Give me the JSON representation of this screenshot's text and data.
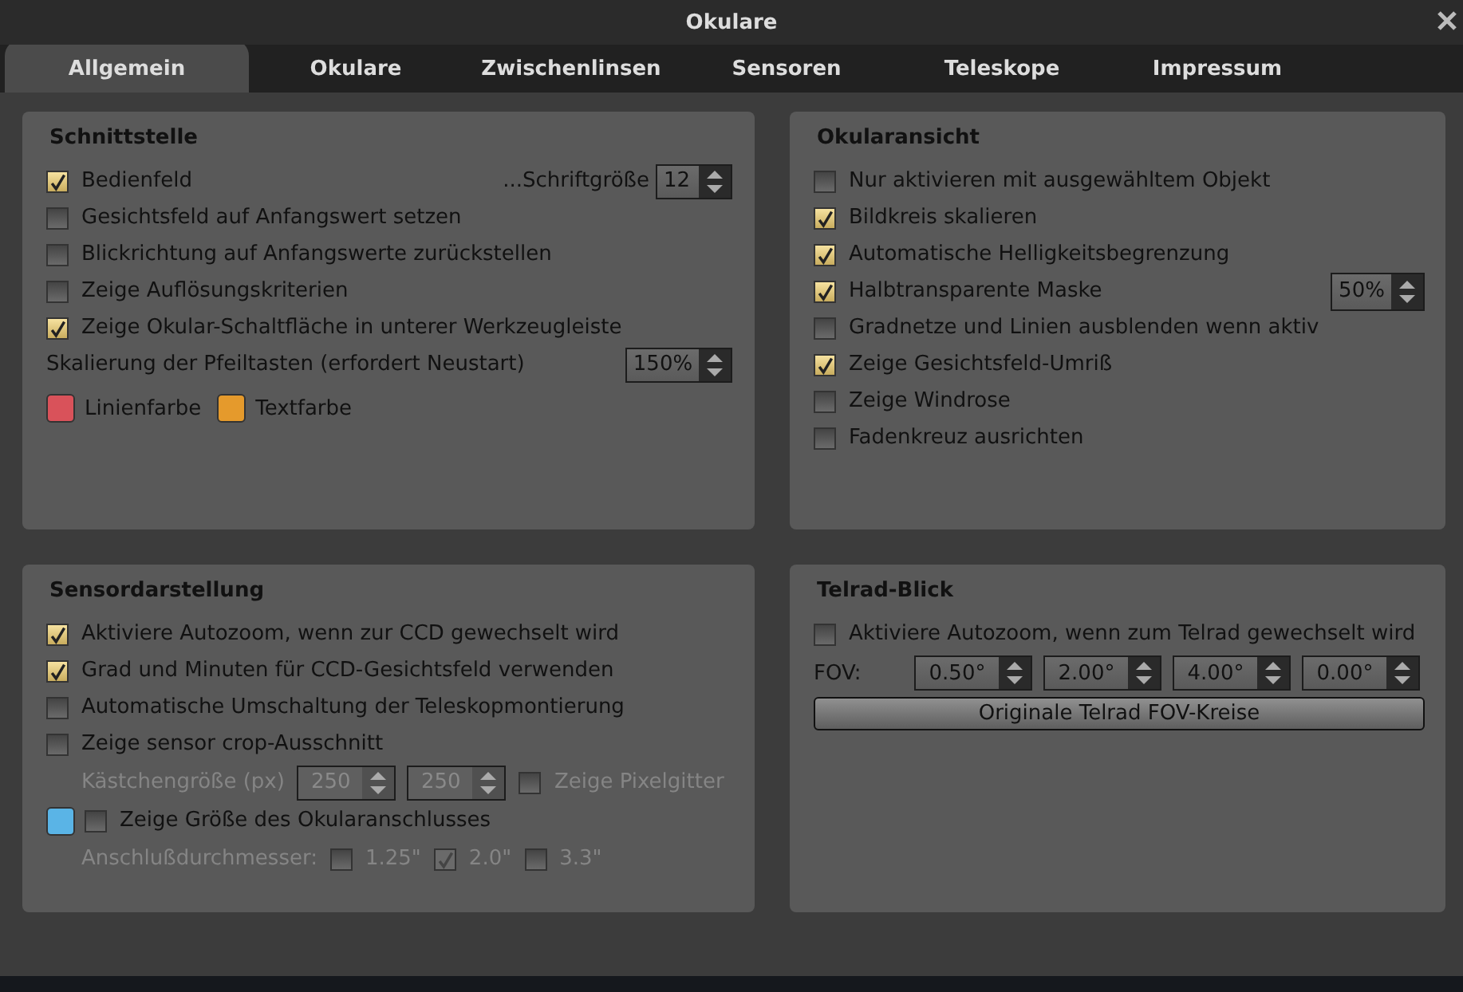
{
  "window": {
    "title": "Okulare"
  },
  "tabs": [
    {
      "label": "Allgemein",
      "selected": true
    },
    {
      "label": "Okulare",
      "selected": false
    },
    {
      "label": "Zwischenlinsen",
      "selected": false
    },
    {
      "label": "Sensoren",
      "selected": false
    },
    {
      "label": "Teleskope",
      "selected": false
    },
    {
      "label": "Impressum",
      "selected": false
    }
  ],
  "panels": [
    {
      "title": "Schnittstelle",
      "rows": [
        {
          "kind": "check",
          "label": "Bedienfeld",
          "checked": true,
          "extra": {
            "label": "...Schriftgröße",
            "value": "12"
          }
        },
        {
          "kind": "check",
          "label": "Gesichtsfeld auf Anfangswert setzen",
          "checked": false
        },
        {
          "kind": "check",
          "label": "Blickrichtung auf Anfangswerte zurückstellen",
          "checked": false
        },
        {
          "kind": "check",
          "label": "Zeige Auflösungskriterien",
          "checked": false
        },
        {
          "kind": "check",
          "label": "Zeige Okular-Schaltfläche in unterer Werkzeugleiste",
          "checked": true
        },
        {
          "kind": "spin",
          "label": "Skalierung der Pfeiltasten (erfordert Neustart)",
          "value": "150%"
        },
        {
          "kind": "colors",
          "swatches": [
            {
              "label": "Linienfarbe",
              "color": "#d9525a"
            },
            {
              "label": "Textfarbe",
              "color": "#e59a2c"
            }
          ]
        }
      ]
    },
    {
      "title": "Okularansicht",
      "rows": [
        {
          "kind": "check",
          "label": "Nur aktivieren mit ausgewähltem Objekt",
          "checked": false
        },
        {
          "kind": "check",
          "label": "Bildkreis skalieren",
          "checked": true
        },
        {
          "kind": "check",
          "label": "Automatische Helligkeitsbegrenzung",
          "checked": true
        },
        {
          "kind": "check",
          "label": "Halbtransparente Maske",
          "checked": true,
          "extra": {
            "value": "50%"
          }
        },
        {
          "kind": "check",
          "label": "Gradnetze und Linien ausblenden wenn aktiv",
          "checked": false
        },
        {
          "kind": "check",
          "label": "Zeige Gesichtsfeld-Umriß",
          "checked": true
        },
        {
          "kind": "check",
          "label": "Zeige Windrose",
          "checked": false
        },
        {
          "kind": "check",
          "label": "Fadenkreuz ausrichten",
          "checked": false
        }
      ]
    },
    {
      "title": "Sensordarstellung",
      "rows": [
        {
          "kind": "check",
          "label": "Aktiviere Autozoom, wenn zur CCD gewechselt wird",
          "checked": true
        },
        {
          "kind": "check",
          "label": "Grad und Minuten für CCD-Gesichtsfeld verwenden",
          "checked": true
        },
        {
          "kind": "check",
          "label": "Automatische Umschaltung der Teleskopmontierung",
          "checked": false
        },
        {
          "kind": "check",
          "label": "Zeige sensor crop-Ausschnitt",
          "checked": false
        },
        {
          "kind": "size",
          "label": "Kästchengröße (px)",
          "disabled": true,
          "values": [
            "250",
            "250"
          ],
          "option": {
            "label": "Zeige Pixelgitter",
            "checked": false
          }
        },
        {
          "kind": "swatchcheck",
          "color": "#5ab4e6",
          "label": "Zeige Größe des Okularanschlusses",
          "checked": false
        },
        {
          "kind": "options",
          "label": "Anschlußdurchmesser:",
          "disabled": true,
          "options": [
            {
              "label": "1.25\"",
              "checked": false
            },
            {
              "label": "2.0\"",
              "checked": true
            },
            {
              "label": "3.3\"",
              "checked": false
            }
          ]
        }
      ]
    },
    {
      "title": "Telrad-Blick",
      "rows": [
        {
          "kind": "check",
          "label": "Aktiviere Autozoom, wenn zum Telrad gewechselt wird",
          "checked": false
        },
        {
          "kind": "fov",
          "label": "FOV:",
          "values": [
            "0.50°",
            "2.00°",
            "4.00°",
            "0.00°"
          ]
        },
        {
          "kind": "button",
          "label": "Originale Telrad FOV-Kreise"
        }
      ]
    }
  ]
}
